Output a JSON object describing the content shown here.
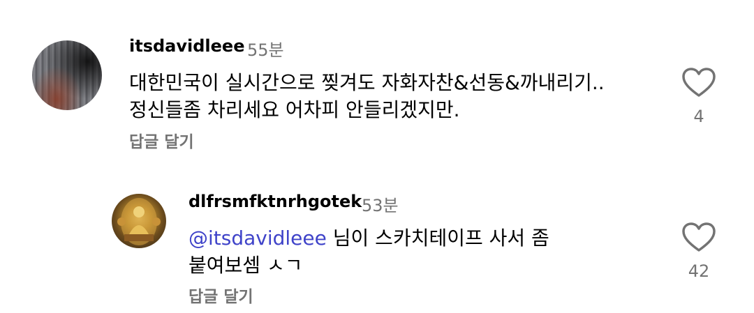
{
  "comments": [
    {
      "avatar": "user-avatar",
      "username": "itsdavidleee",
      "time": "55분",
      "lines": [
        "대한민국이 실시간으로 찢겨도 자화자찬&선동&까내리기..",
        "정신들좀 차리세요 어차피 안들리겠지만."
      ],
      "reply_label": "답글 달기",
      "like_icon": "heart-outline-icon",
      "likes": "4"
    },
    {
      "avatar": "buddha-statue-avatar",
      "username": "dlfrsmfktnrhgotek",
      "time": "53분",
      "mention_symbol": "@",
      "mention": "itsdavidleee",
      "line1_rest": " 님이 스카치테이프 사서 좀",
      "line2": "붙여보셈 ㅅㄱ",
      "reply_label": "답글 달기",
      "like_icon": "heart-outline-icon",
      "likes": "42"
    }
  ],
  "colors": {
    "text": "#000000",
    "secondary": "#737373",
    "mention": "#3f43c9",
    "background": "#ffffff"
  }
}
